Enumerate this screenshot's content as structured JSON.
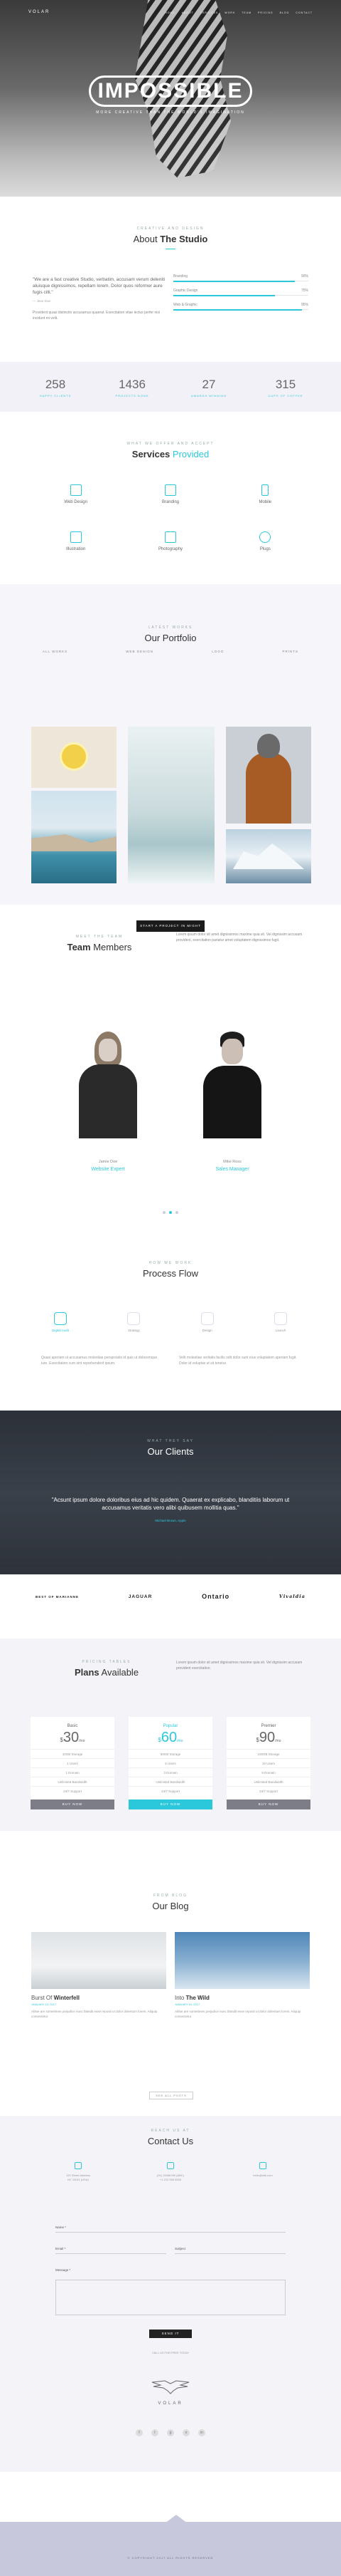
{
  "hero": {
    "logo": "VOLAR",
    "menu": [
      "HOME",
      "ABOUT",
      "SERVICES",
      "WORK",
      "TEAM",
      "PRICING",
      "BLOG",
      "CONTACT"
    ],
    "title": "IMPOSSIBLE",
    "subtitle": "MORE CREATIVE THAN THE WORLD'S IMAGINATION"
  },
  "studio": {
    "kicker": "CREATIVE AND DESIGN",
    "title_light": "About",
    "title_bold": "The Studio",
    "quote": "\"We are a fast creative Studio, verbatim, accusam verum deleniti aluisque dignissimos, repellam lorem. Dolor quos reformer aure fugis cilli.\"",
    "quote_by": "— Jane Doe",
    "paragraph": "Provident quasi distinctio accusamus quaerat. Exercitation vitae lectus perfer nisi incidunt mi velit.",
    "skills": [
      {
        "label": "Branding",
        "percent": "90%",
        "value": 90
      },
      {
        "label": "Graphic Design",
        "percent": "75%",
        "value": 75
      },
      {
        "label": "Web & Graphic",
        "percent": "95%",
        "value": 95
      }
    ]
  },
  "stats": [
    {
      "number": "258",
      "label": "HAPPY CLIENTS"
    },
    {
      "number": "1436",
      "label": "PROJECTS DONE"
    },
    {
      "number": "27",
      "label": "AWARDS WINNING"
    },
    {
      "number": "315",
      "label": "CUPS OF COFFEE"
    }
  ],
  "services": {
    "kicker": "WHAT WE OFFER AND ACCEPT",
    "title_bold": "Services",
    "title_light": "Provided",
    "items": [
      {
        "label": "Web Design",
        "icon": "monitor-icon"
      },
      {
        "label": "Branding",
        "icon": "brush-icon"
      },
      {
        "label": "Mobile",
        "icon": "mobile-icon"
      },
      {
        "label": "Illustration",
        "icon": "flag-icon"
      },
      {
        "label": "Photography",
        "icon": "camera-icon"
      },
      {
        "label": "Plugs",
        "icon": "plug-icon"
      }
    ]
  },
  "portfolio": {
    "kicker": "LATEST WORKS",
    "title": "Our Portfolio",
    "filters": [
      "ALL WORKS",
      "WEB DESIGN",
      "LOGO",
      "PRINTS"
    ],
    "button": "START A PROJECT IN MIGHT"
  },
  "team": {
    "kicker": "MEET THE TEAM",
    "title_bold": "Team",
    "title_light": "Members",
    "text": "Lorem ipsum dolor sit amet dignissimos maxime quia sit. Vel dignissim accusam provident, exercitation pariatur amet voluptatem dignissimos fugit.",
    "members": [
      {
        "name": "Jamie Doe",
        "role": "Website Expert"
      },
      {
        "name": "Mike Ross",
        "role": "Sales Manager"
      }
    ]
  },
  "process": {
    "kicker": "HOW WE WORK",
    "title": "Process Flow",
    "steps": [
      "Digital Audit",
      "Strategy",
      "Design",
      "Launch"
    ],
    "text_left": "Quasi aperiam ut accusamus molestiae perspiciatis id quis ut doloremque iure. Exercitation cum sint reprehenderit ipsum.",
    "text_right": "Velit molestiae veritatis facilis odit dolor sunt eius voluptatem aperiam fugit. Dolor id voluptas ut sit tenetur."
  },
  "clients": {
    "kicker": "WHAT THEY SAY",
    "title": "Our Clients",
    "quote": "\"Acsunt ipsum dolore doloribus eius ad hic quidem. Quaerat ex explicabo, blanditiis laborum ut accusamus veritatis vero alibi quibusem mollitia quas.\"",
    "by": "Michael Brown, Apple"
  },
  "logos": [
    "BEST OF MARIANNE",
    "JAGUAR",
    "Ontario",
    "Vivaldia"
  ],
  "plans": {
    "kicker": "PRICING TABLES",
    "title_bold": "Plans",
    "title_light": "Available",
    "text": "Lorem ipsum dolor sit amet dignissimos maxime quia sit. Vel dignissim accusam provident exercitation.",
    "cards": [
      {
        "name": "Basic",
        "currency": "$",
        "price": "30",
        "period": "/mo",
        "features": [
          "10GB Storage",
          "1 Users",
          "1 Domain",
          "Unlimited Bandwidth",
          "24/7 Support"
        ],
        "button": "BUY NOW"
      },
      {
        "name": "Popular",
        "currency": "$",
        "price": "60",
        "period": "/mo",
        "features": [
          "50GB Storage",
          "5 Users",
          "3 Domain",
          "Unlimited Bandwidth",
          "24/7 Support"
        ],
        "button": "BUY NOW"
      },
      {
        "name": "Premier",
        "currency": "$",
        "price": "90",
        "period": "/mo",
        "features": [
          "100GB Storage",
          "10 Users",
          "5 Domain",
          "Unlimited Bandwidth",
          "24/7 Support"
        ],
        "button": "BUY NOW"
      }
    ]
  },
  "blog": {
    "kicker": "FROM BLOG",
    "title": "Our Blog",
    "posts": [
      {
        "light": "Burst Of",
        "bold": "Winterfell",
        "date": "JANUARY 10, 2017",
        "excerpt": "Ablue are sometimes prejudice nunc blandit esse reposit ut dolor dolentum lorem. Aliquip consectetur."
      },
      {
        "light": "Into",
        "bold": "The Wild",
        "date": "JANUARY 10, 2017",
        "excerpt": "Ablue are sometimes prejudice nunc blandit esse reposit ut dolor dolentum lorem. Aliquip consectetur."
      }
    ],
    "more": "SEE ALL POSTS"
  },
  "contact": {
    "kicker": "REACH US AT",
    "title": "Contact Us",
    "infos": [
      {
        "line1": "123 Street Address",
        "line2": "NY 10011 (USA)"
      },
      {
        "line1": "(01) 23456789 (ABC)",
        "line2": "+1 212 555 5555"
      },
      {
        "line1": "hello@site.com",
        "line2": ""
      }
    ],
    "name_label": "Name *",
    "email_label": "Email *",
    "subject_label": "Subject",
    "message_label": "Message *",
    "send": "SEND IT",
    "note": "CALL US FOR FREE TODAY",
    "footer_logo": "VOLAR"
  },
  "footer": {
    "copy": "© COPYRIGHT 2017 ALL RIGHTS RESERVED"
  }
}
